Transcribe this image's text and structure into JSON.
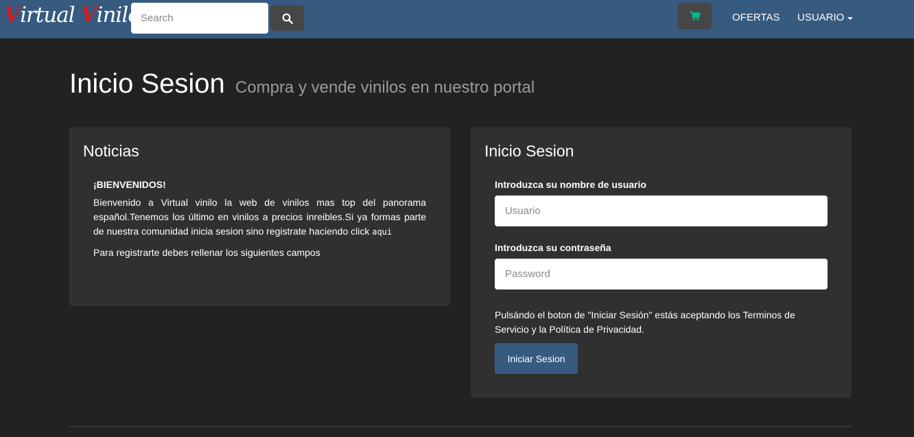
{
  "navbar": {
    "brand_part1": "V",
    "brand_part2": "irtual ",
    "brand_part3": "V",
    "brand_part4": "inilo",
    "search_placeholder": "Search",
    "search_icon": "search-icon",
    "cart_icon": "shopping-cart-icon",
    "ofertas_label": "OFERTAS",
    "usuario_label": "USUARIO",
    "colors": {
      "bar": "#375a7f",
      "brand_accent": "#d11a22",
      "cart_icon": "#00bc8c"
    }
  },
  "header": {
    "title": "Inicio Sesion",
    "subtitle": "Compra y vende vinilos en nuestro portal"
  },
  "news": {
    "title": "Noticias",
    "heading": "¡BIENVENIDOS!",
    "body": "Bienvenido a Virtual vinilo la web de vinilos mas top del panorama español.Tenemos los último en vinilos a precios inreibles.Si ya formas parte de nuestra comunidad inicia sesion sino registrate haciendo click ",
    "link_code": "aqui",
    "note": "Para registrarte debes rellenar los siguientes campos"
  },
  "login": {
    "title": "Inicio Sesion",
    "user_label": "Introduzca su nombre de usuario",
    "user_placeholder": "Usuario",
    "pass_label": "Introduzca su contraseña",
    "pass_placeholder": "Password",
    "terms": "Pulsándo el boton de \"Iniciar Sesión\" estás aceptando los Terminos de Servicio y la Política de Privacidad.",
    "submit_label": "Iniciar Sesion"
  }
}
